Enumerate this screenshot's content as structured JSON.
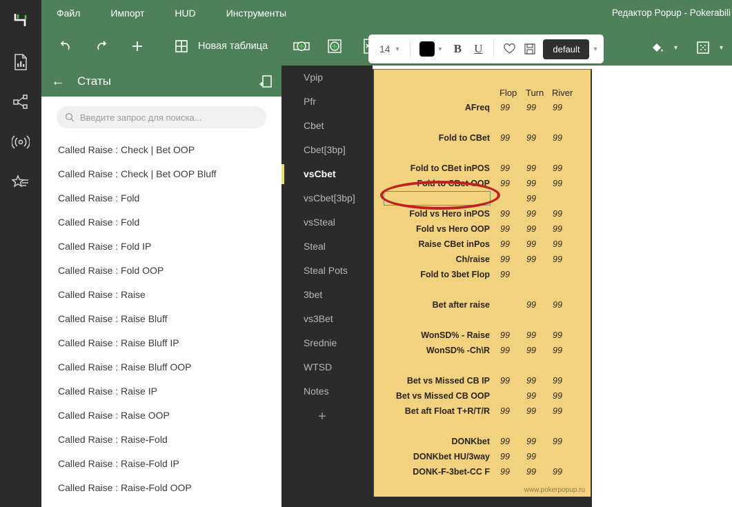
{
  "app": {
    "window_title": "Редактор Popup - Pokerabili",
    "accent_green": "#4f8159",
    "dark": "#2b2b2b",
    "popup_yellow": "#f2d27e",
    "annotation_red": "#c0201e",
    "selection_teal": "#4e9e94",
    "tab_highlight": "#e8e36a"
  },
  "rail": {
    "logo": "h-logo-icon",
    "items": [
      {
        "icon": "report-document-icon",
        "name": "reports"
      },
      {
        "icon": "share-network-icon",
        "name": "share"
      },
      {
        "icon": "broadcast-icon",
        "name": "broadcast"
      },
      {
        "icon": "star-list-icon",
        "name": "favorites"
      }
    ]
  },
  "menubar": {
    "items": [
      "Файл",
      "Импорт",
      "HUD",
      "Инструменты"
    ]
  },
  "toolbar": {
    "undo": "undo-icon",
    "redo": "redo-icon",
    "add": "plus-icon",
    "new_table_label": "Новая таблица",
    "new_table_icon": "grid-icon",
    "add_row_icon": "add-row-icon",
    "add_col_icon": "add-column-icon",
    "del_row_icon": "delete-row-icon",
    "del_col_icon": "delete-column-icon",
    "font_size": "14",
    "text_color": "#000000",
    "bold_label": "B",
    "underline_label": "U",
    "favorite_icon": "heart-icon",
    "save_icon": "save-icon",
    "style_label": "default",
    "fill_icon": "paint-bucket-icon",
    "border_icon": "borders-icon"
  },
  "stats_panel": {
    "back_icon": "back-arrow-icon",
    "title": "Статы",
    "pin_icon": "dock-panel-icon",
    "search": {
      "icon": "search-icon",
      "placeholder": "Введите запрос для поиска...",
      "value": ""
    },
    "items": [
      "Called Raise : Check | Bet OOP",
      "Called Raise : Check | Bet OOP Bluff",
      "Called Raise : Fold",
      "Called Raise : Fold",
      "Called Raise : Fold IP",
      "Called Raise : Fold OOP",
      "Called Raise : Raise",
      "Called Raise : Raise Bluff",
      "Called Raise : Raise Bluff IP",
      "Called Raise : Raise Bluff OOP",
      "Called Raise : Raise IP",
      "Called Raise : Raise OOP",
      "Called Raise : Raise-Fold",
      "Called Raise : Raise-Fold IP",
      "Called Raise : Raise-Fold OOP"
    ]
  },
  "tabs": {
    "active": "vsCbet",
    "items": [
      "Vpip",
      "Pfr",
      "Cbet",
      "Cbet[3bp]",
      "vsCbet",
      "vsCbet[3bp]",
      "vsSteal",
      "Steal",
      "Steal Pots",
      "3bet",
      "vs3Bet",
      "Srednie",
      "WTSD",
      "Notes"
    ],
    "add_icon": "plus-icon"
  },
  "popup_table": {
    "columns": [
      "Flop",
      "Turn",
      "River"
    ],
    "footer": "www.pokerpopup.ru",
    "selected_cell": {
      "row_index": 5,
      "column": "label",
      "value": ""
    },
    "rows": [
      {
        "label": "",
        "values": [
          "",
          "",
          ""
        ],
        "header": true
      },
      {
        "label": "AFreq",
        "values": [
          "99",
          "99",
          "99"
        ]
      },
      {
        "label": "",
        "values": [
          "",
          "",
          ""
        ]
      },
      {
        "label": "Fold to CBet",
        "values": [
          "99",
          "99",
          "99"
        ]
      },
      {
        "label": "",
        "values": [
          "",
          "",
          ""
        ]
      },
      {
        "label": "Fold to CBet inPOS",
        "values": [
          "99",
          "99",
          "99"
        ]
      },
      {
        "label": "Fold to CBet OOP",
        "values": [
          "99",
          "99",
          "99"
        ]
      },
      {
        "label": "",
        "values": [
          "",
          "99",
          ""
        ],
        "selected": true
      },
      {
        "label": "Fold vs Hero inPOS",
        "values": [
          "99",
          "99",
          "99"
        ]
      },
      {
        "label": "Fold vs Hero OOP",
        "values": [
          "99",
          "99",
          "99"
        ]
      },
      {
        "label": "Raise CBet inPos",
        "values": [
          "99",
          "99",
          "99"
        ]
      },
      {
        "label": "Ch/raise",
        "values": [
          "99",
          "99",
          "99"
        ]
      },
      {
        "label": "Fold to 3bet Flop",
        "values": [
          "99",
          "",
          ""
        ]
      },
      {
        "label": "",
        "values": [
          "",
          "",
          ""
        ]
      },
      {
        "label": "Bet after raise",
        "values": [
          "",
          "99",
          "99"
        ]
      },
      {
        "label": "",
        "values": [
          "",
          "",
          ""
        ]
      },
      {
        "label": "WonSD% - Raise",
        "values": [
          "99",
          "99",
          "99"
        ]
      },
      {
        "label": "WonSD% -Ch\\R",
        "values": [
          "99",
          "99",
          "99"
        ]
      },
      {
        "label": "",
        "values": [
          "",
          "",
          ""
        ]
      },
      {
        "label": "Bet vs Missed CB IP",
        "values": [
          "99",
          "99",
          "99"
        ]
      },
      {
        "label": "Bet vs Missed CB OOP",
        "values": [
          "",
          "99",
          "99"
        ]
      },
      {
        "label": "Bet aft Float T+R/T/R",
        "values": [
          "99",
          "99",
          "99"
        ]
      },
      {
        "label": "",
        "values": [
          "",
          "",
          ""
        ]
      },
      {
        "label": "DONKbet",
        "values": [
          "99",
          "99",
          "99"
        ]
      },
      {
        "label": "DONKbet HU/3way",
        "values": [
          "99",
          "99",
          ""
        ]
      },
      {
        "label": "DONK-F-3bet-CC F",
        "values": [
          "99",
          "99",
          "99"
        ]
      }
    ]
  }
}
